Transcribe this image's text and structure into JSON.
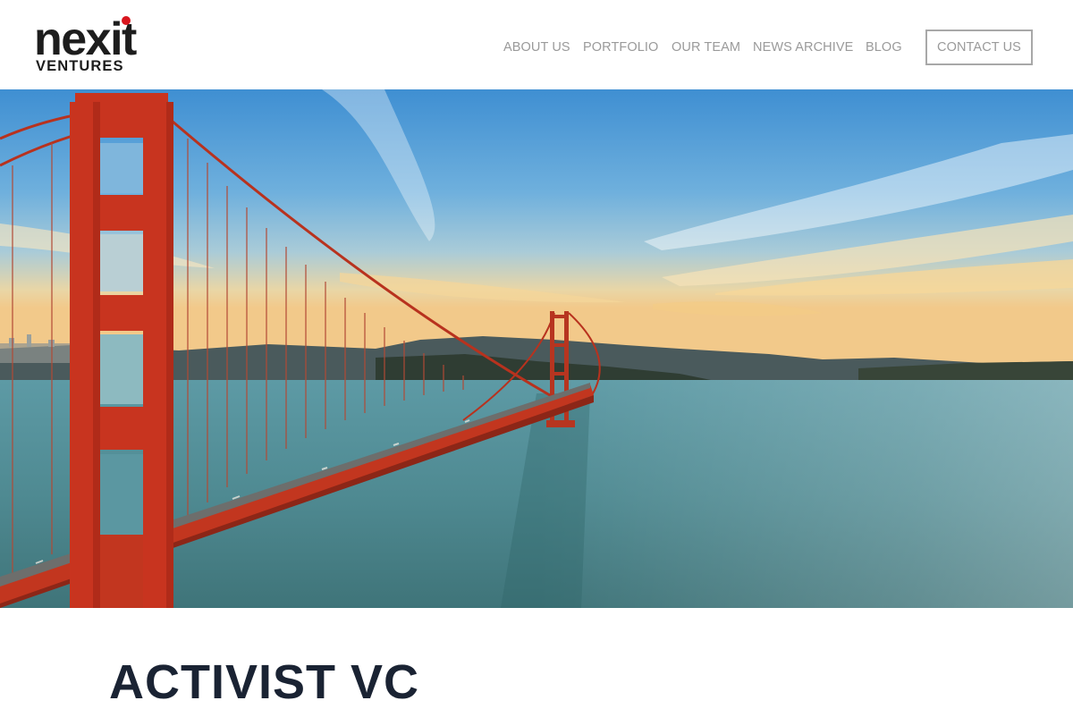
{
  "brand": {
    "logo_word": "nexit",
    "logo_sub": "VENTURES",
    "accent_color": "#d8161e",
    "text_color": "#1d1d1d"
  },
  "nav": {
    "items": [
      {
        "label": "ABOUT US"
      },
      {
        "label": "PORTFOLIO"
      },
      {
        "label": "OUR TEAM"
      },
      {
        "label": "NEWS ARCHIVE"
      },
      {
        "label": "BLOG"
      }
    ],
    "contact_label": "CONTACT US",
    "link_color": "#9a9a9a"
  },
  "hero": {
    "image_subject": "golden-gate-bridge-photo",
    "bridge_color": "#c8341f"
  },
  "intro": {
    "title": "ACTIVIST VC"
  }
}
